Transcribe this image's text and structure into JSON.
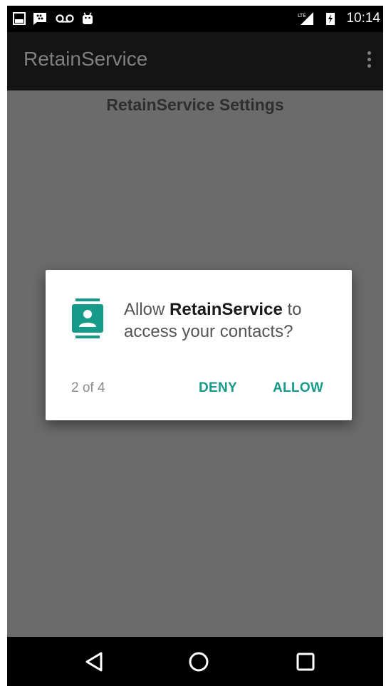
{
  "status_bar": {
    "time": "10:14",
    "left_icons": [
      "gallery-icon",
      "blackberry-messenger-icon",
      "voicemail-icon",
      "android-icon"
    ],
    "right_icons": [
      "signal-icon",
      "battery-charging-icon"
    ]
  },
  "app_bar": {
    "title": "RetainService",
    "menu_icon": "overflow-menu-icon"
  },
  "main": {
    "heading": "RetainService Settings"
  },
  "dialog": {
    "icon": "contacts-icon",
    "message_prefix": "Allow ",
    "app_name": "RetainService",
    "message_suffix": " to access your contacts?",
    "counter": "2 of 4",
    "deny_label": "DENY",
    "allow_label": "ALLOW",
    "accent_color": "#169a8a"
  },
  "nav_bar": {
    "back_icon": "back-icon",
    "home_icon": "home-icon",
    "recents_icon": "recents-icon"
  }
}
